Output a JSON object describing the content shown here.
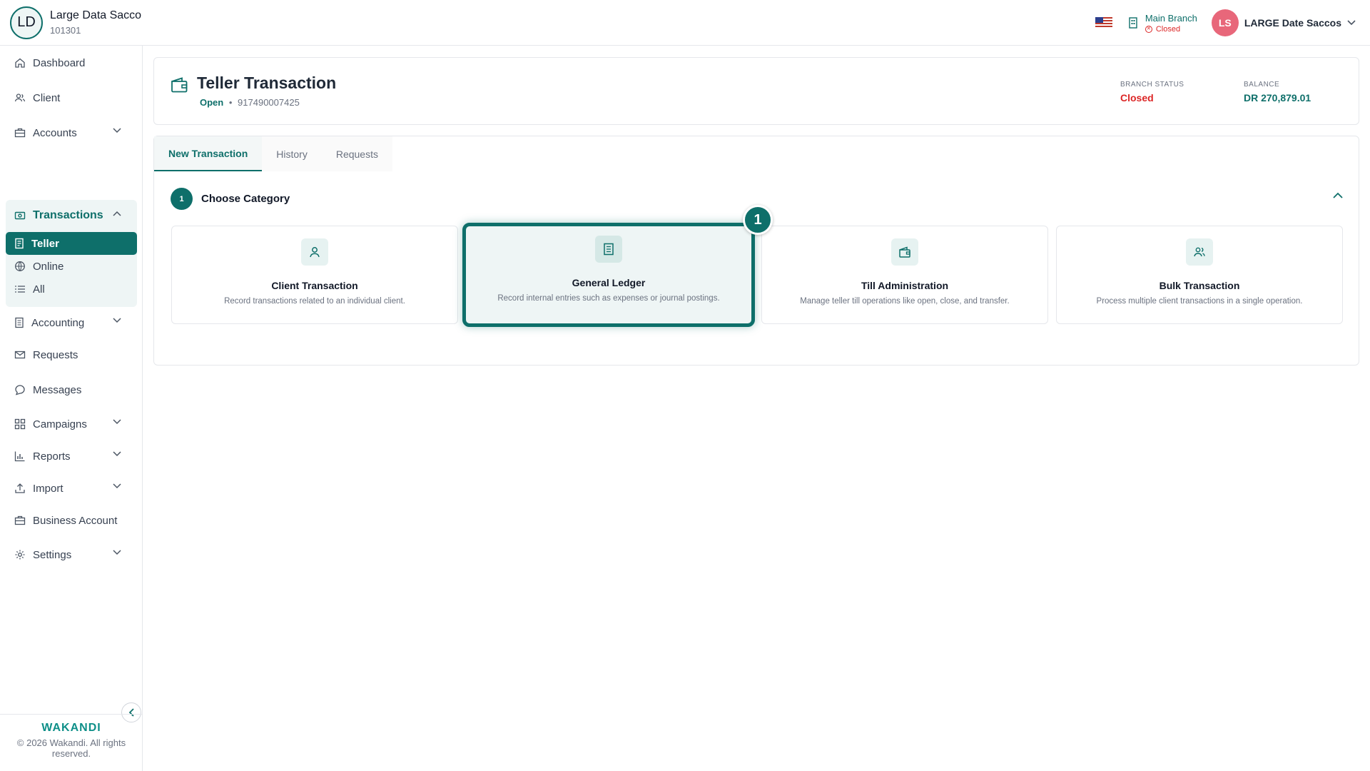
{
  "org": {
    "initials": "LD",
    "name": "Large Data Sacco",
    "code": "101301"
  },
  "header": {
    "branch_name": "Main Branch",
    "branch_status": "Closed",
    "user_initials": "LS",
    "user_name": "LARGE Date Saccos"
  },
  "sidebar": {
    "dashboard": "Dashboard",
    "client": "Client",
    "accounts": "Accounts",
    "transactions": "Transactions",
    "teller": "Teller",
    "online": "Online",
    "all": "All",
    "accounting": "Accounting",
    "requests": "Requests",
    "messages": "Messages",
    "campaigns": "Campaigns",
    "reports": "Reports",
    "import": "Import",
    "business_account": "Business Account",
    "settings": "Settings"
  },
  "footer": {
    "brand": "WAKANDI",
    "copyright": "© 2026 Wakandi. All rights reserved."
  },
  "page": {
    "title": "Teller Transaction",
    "status": "Open",
    "separator": "•",
    "account_number": "917490007425",
    "branch_status_label": "BRANCH STATUS",
    "branch_status_value": "Closed",
    "balance_label": "BALANCE",
    "balance_value": "DR 270,879.01"
  },
  "tabs": {
    "new": "New Transaction",
    "history": "History",
    "requests": "Requests"
  },
  "step": {
    "number": "1",
    "title": "Choose Category"
  },
  "categories": [
    {
      "title": "Client Transaction",
      "desc": "Record transactions related to an individual client."
    },
    {
      "title": "General Ledger",
      "desc": "Record internal entries such as expenses or journal postings."
    },
    {
      "title": "Till Administration",
      "desc": "Manage teller till operations like open, close, and transfer."
    },
    {
      "title": "Bulk Transaction",
      "desc": "Process multiple client transactions in a single operation."
    }
  ],
  "annotation_marker": "1",
  "colors": {
    "primary": "#0e6f6a",
    "danger": "#dc2626",
    "avatar": "#e8677a"
  }
}
